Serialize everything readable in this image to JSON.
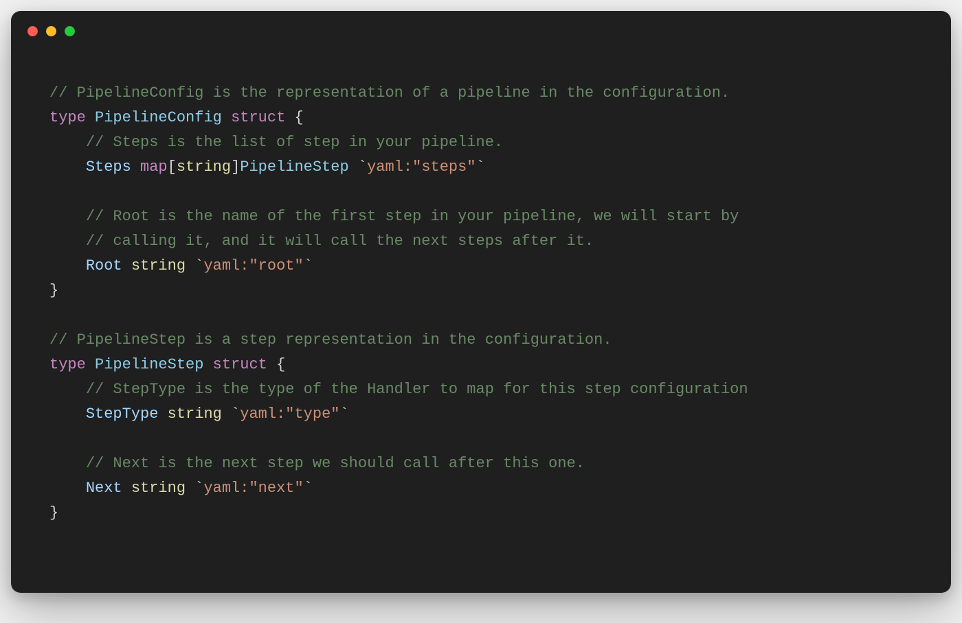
{
  "window": {
    "traffic_lights": {
      "red": "●",
      "yellow": "●",
      "green": "●"
    }
  },
  "code": {
    "indent": "    ",
    "lines": [
      {
        "tokens": [
          {
            "cls": "comment",
            "text": "// PipelineConfig is the representation of a pipeline in the configuration."
          }
        ]
      },
      {
        "tokens": [
          {
            "cls": "keyword",
            "text": "type "
          },
          {
            "cls": "type",
            "text": "PipelineConfig"
          },
          {
            "cls": "plain",
            "text": " "
          },
          {
            "cls": "struct",
            "text": "struct"
          },
          {
            "cls": "plain",
            "text": " {"
          }
        ]
      },
      {
        "indent": 1,
        "tokens": [
          {
            "cls": "comment",
            "text": "// Steps is the list of step in your pipeline."
          }
        ]
      },
      {
        "indent": 1,
        "tokens": [
          {
            "cls": "field",
            "text": "Steps "
          },
          {
            "cls": "keyword",
            "text": "map"
          },
          {
            "cls": "plain",
            "text": "["
          },
          {
            "cls": "builtin",
            "text": "string"
          },
          {
            "cls": "plain",
            "text": "]"
          },
          {
            "cls": "type",
            "text": "PipelineStep"
          },
          {
            "cls": "plain",
            "text": " `"
          },
          {
            "cls": "string",
            "text": "yaml:\"steps\""
          },
          {
            "cls": "plain",
            "text": "`"
          }
        ]
      },
      {
        "tokens": []
      },
      {
        "indent": 1,
        "tokens": [
          {
            "cls": "comment",
            "text": "// Root is the name of the first step in your pipeline, we will start by"
          }
        ]
      },
      {
        "indent": 1,
        "tokens": [
          {
            "cls": "comment",
            "text": "// calling it, and it will call the next steps after it."
          }
        ]
      },
      {
        "indent": 1,
        "tokens": [
          {
            "cls": "field",
            "text": "Root "
          },
          {
            "cls": "builtin",
            "text": "string"
          },
          {
            "cls": "plain",
            "text": " `"
          },
          {
            "cls": "string",
            "text": "yaml:\"root\""
          },
          {
            "cls": "plain",
            "text": "`"
          }
        ]
      },
      {
        "tokens": [
          {
            "cls": "plain",
            "text": "}"
          }
        ]
      },
      {
        "tokens": []
      },
      {
        "tokens": [
          {
            "cls": "comment",
            "text": "// PipelineStep is a step representation in the configuration."
          }
        ]
      },
      {
        "tokens": [
          {
            "cls": "keyword",
            "text": "type "
          },
          {
            "cls": "type",
            "text": "PipelineStep"
          },
          {
            "cls": "plain",
            "text": " "
          },
          {
            "cls": "struct",
            "text": "struct"
          },
          {
            "cls": "plain",
            "text": " {"
          }
        ]
      },
      {
        "indent": 1,
        "tokens": [
          {
            "cls": "comment",
            "text": "// StepType is the type of the Handler to map for this step configuration"
          }
        ]
      },
      {
        "indent": 1,
        "tokens": [
          {
            "cls": "field",
            "text": "StepType "
          },
          {
            "cls": "builtin",
            "text": "string"
          },
          {
            "cls": "plain",
            "text": " `"
          },
          {
            "cls": "string",
            "text": "yaml:\"type\""
          },
          {
            "cls": "plain",
            "text": "`"
          }
        ]
      },
      {
        "tokens": []
      },
      {
        "indent": 1,
        "tokens": [
          {
            "cls": "comment",
            "text": "// Next is the next step we should call after this one."
          }
        ]
      },
      {
        "indent": 1,
        "tokens": [
          {
            "cls": "field",
            "text": "Next "
          },
          {
            "cls": "builtin",
            "text": "string"
          },
          {
            "cls": "plain",
            "text": " `"
          },
          {
            "cls": "string",
            "text": "yaml:\"next\""
          },
          {
            "cls": "plain",
            "text": "`"
          }
        ]
      },
      {
        "tokens": [
          {
            "cls": "plain",
            "text": "}"
          }
        ]
      }
    ]
  }
}
